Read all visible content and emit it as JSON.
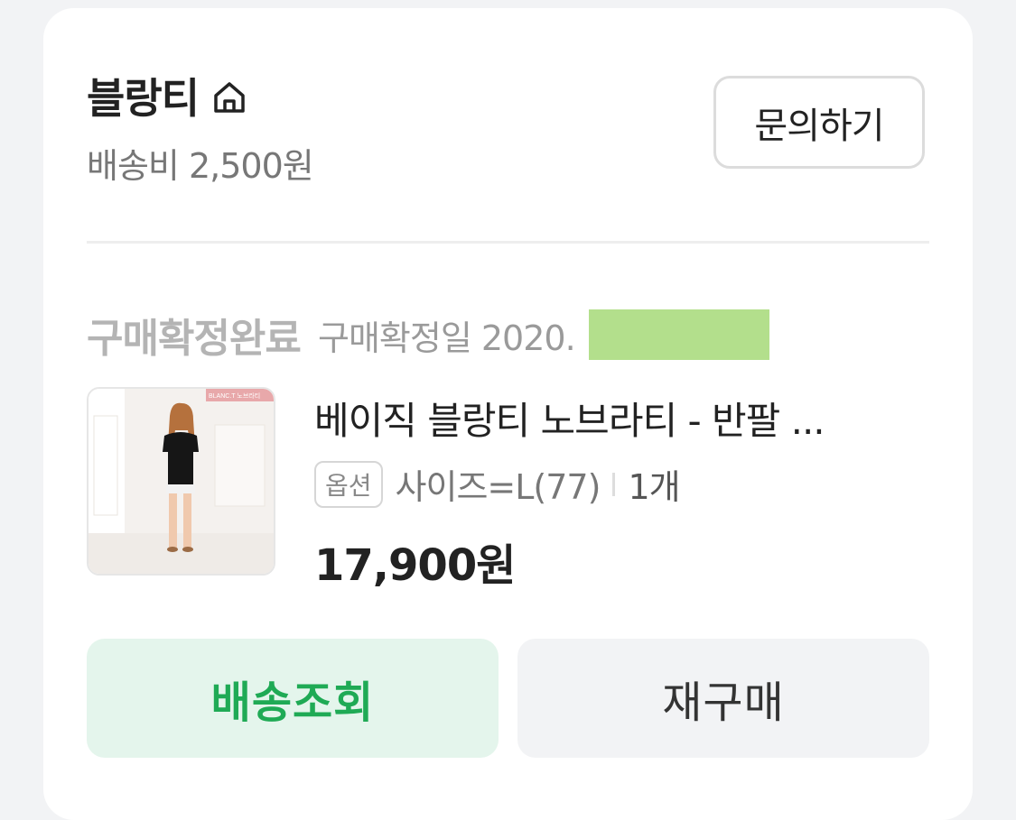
{
  "store": {
    "name": "블랑티",
    "home_icon": "home-icon",
    "shipping_fee": "배송비 2,500원",
    "inquiry_label": "문의하기"
  },
  "order": {
    "status": "구매확정완료",
    "confirm_date": "구매확정일 2020."
  },
  "product": {
    "title": "베이직 블랑티 노브라티 - 반팔 ...",
    "thumb_brand": "BLANC.T 노브라티",
    "option_tag": "옵션",
    "option_value": "사이즈=L(77)",
    "quantity": "1개",
    "price": "17,900원"
  },
  "actions": {
    "track_label": "배송조회",
    "rebuy_label": "재구매"
  },
  "colors": {
    "accent_green": "#1faa55",
    "track_bg": "#e4f5ec",
    "redaction": "#b3df8c"
  }
}
